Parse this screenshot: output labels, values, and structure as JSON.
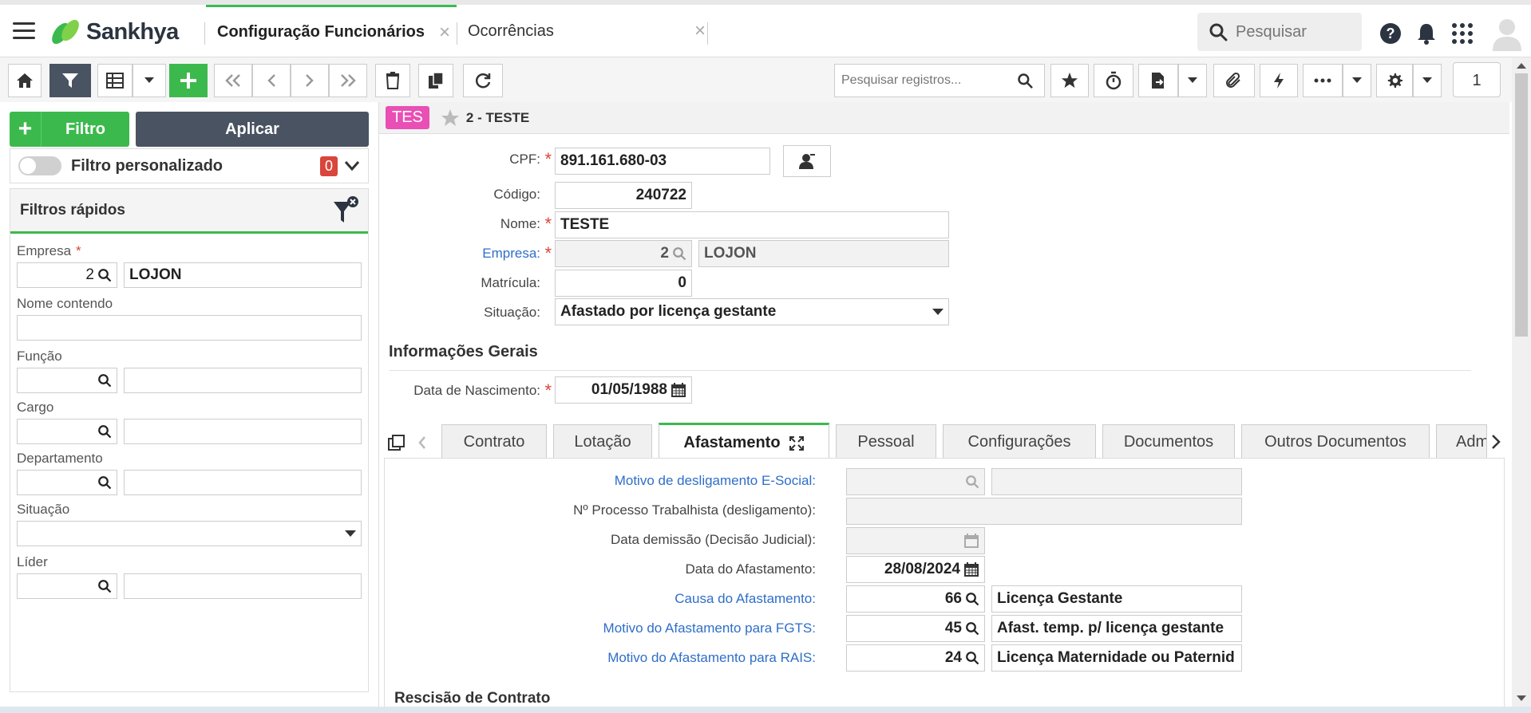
{
  "header": {
    "brand": "Sankhya",
    "tabs": [
      {
        "label": "Configuração Funcionários",
        "active": true
      },
      {
        "label": "Ocorrências",
        "active": false
      }
    ],
    "search_placeholder": "Pesquisar",
    "icons": [
      "help-icon",
      "bell-icon",
      "apps-grid-icon",
      "user-avatar-icon"
    ]
  },
  "toolbar": {
    "record_search_placeholder": "Pesquisar registros...",
    "page_number": "1"
  },
  "filters": {
    "filtro_label": "Filtro",
    "aplicar_label": "Aplicar",
    "custom_label": "Filtro personalizado",
    "custom_count": "0",
    "quick_title": "Filtros rápidos",
    "empresa_label": "Empresa",
    "empresa_code": "2",
    "empresa_name": "LOJON",
    "nome_label": "Nome contendo",
    "funcao_label": "Função",
    "cargo_label": "Cargo",
    "departamento_label": "Departamento",
    "situacao_label": "Situação",
    "lider_label": "Líder"
  },
  "record": {
    "badge": "TES",
    "title": "2 - TESTE",
    "cpf_label": "CPF:",
    "cpf": "891.161.680-03",
    "codigo_label": "Código:",
    "codigo": "240722",
    "nome_label": "Nome:",
    "nome": "TESTE",
    "empresa_label": "Empresa:",
    "empresa_code": "2",
    "empresa_name": "LOJON",
    "matricula_label": "Matrícula:",
    "matricula": "0",
    "situacao_label": "Situação:",
    "situacao": "Afastado por licença gestante",
    "info_title": "Informações Gerais",
    "nascimento_label": "Data de Nascimento:",
    "nascimento": "01/05/1988"
  },
  "detail_tabs": [
    "Contrato",
    "Lotação",
    "Afastamento",
    "Pessoal",
    "Configurações",
    "Documentos",
    "Outros Documentos",
    "Adm"
  ],
  "afastamento": {
    "motivo_deslig_label": "Motivo de desligamento E-Social:",
    "processo_label": "Nº Processo Trabalhista (desligamento):",
    "data_demissao_label": "Data demissão (Decisão Judicial):",
    "data_afast_label": "Data do Afastamento:",
    "data_afast": "28/08/2024",
    "causa_label": "Causa do Afastamento:",
    "causa_code": "66",
    "causa_desc": "Licença Gestante",
    "fgts_label": "Motivo do Afastamento para FGTS:",
    "fgts_code": "45",
    "fgts_desc": "Afast. temp. p/ licença gestante",
    "rais_label": "Motivo do Afastamento para RAIS:",
    "rais_code": "24",
    "rais_desc": "Licença Maternidade ou Paternid",
    "rescisao_title": "Rescisão de Contrato"
  }
}
